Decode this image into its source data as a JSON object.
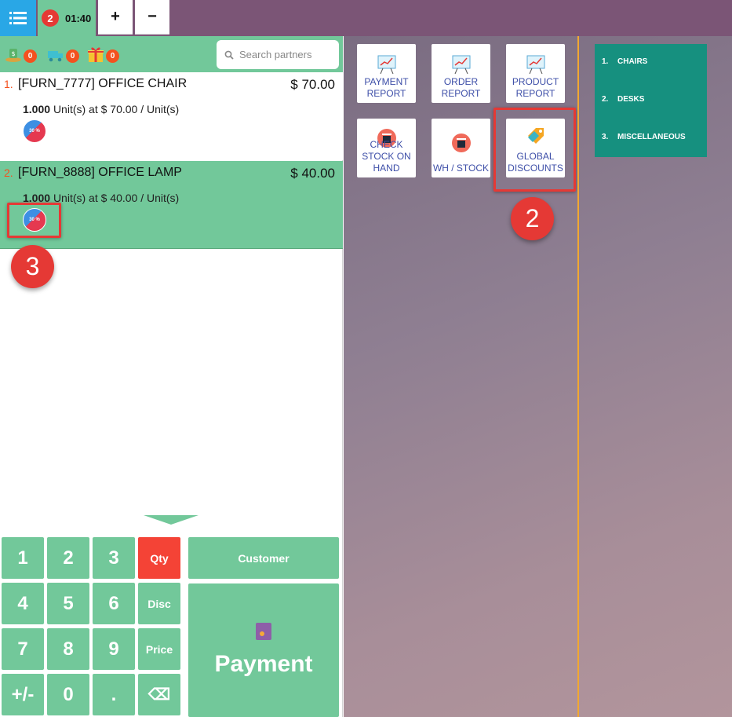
{
  "topbar": {
    "order_count": "2",
    "order_time": "01:40",
    "add_label": "+",
    "remove_label": "−"
  },
  "header": {
    "counters": [
      {
        "icon": "cash-icon",
        "count": "0"
      },
      {
        "icon": "delivery-truck-icon",
        "count": "0"
      },
      {
        "icon": "gift-icon",
        "count": "0"
      }
    ],
    "search_placeholder": "Search partners"
  },
  "order_lines": [
    {
      "index": "1.",
      "name": "[FURN_7777] OFFICE CHAIR",
      "price": "$ 70.00",
      "qty": "1.000",
      "unit_text": "Unit(s) at $ 70.00 / Unit(s)"
    },
    {
      "index": "2.",
      "name": "[FURN_8888] OFFICE LAMP",
      "price": "$ 40.00",
      "qty": "1.000",
      "unit_text": "Unit(s) at $ 40.00 / Unit(s)"
    }
  ],
  "promo_badge_text": "30 %",
  "annotations": {
    "step_2": "2",
    "step_3": "3"
  },
  "numpad": {
    "keys": [
      "1",
      "2",
      "3",
      "4",
      "5",
      "6",
      "7",
      "8",
      "9",
      "+/-",
      "0",
      "."
    ],
    "modes": {
      "qty": "Qty",
      "disc": "Disc",
      "price": "Price"
    },
    "backspace": "⌫"
  },
  "actions": {
    "customer": "Customer",
    "payment": "Payment"
  },
  "tiles": [
    {
      "label": "PAYMENT REPORT",
      "icon": "chart-report-icon"
    },
    {
      "label": "ORDER REPORT",
      "icon": "chart-report-icon"
    },
    {
      "label": "PRODUCT REPORT",
      "icon": "chart-report-icon"
    },
    {
      "label": "CHECK STOCK ON HAND",
      "icon": "stock-icon"
    },
    {
      "label": "WH / STOCK",
      "icon": "stock-icon"
    },
    {
      "label": "GLOBAL DISCOUNTS",
      "icon": "discount-tag-icon"
    }
  ],
  "categories": [
    {
      "num": "1.",
      "name": "CHAIRS"
    },
    {
      "num": "2.",
      "name": "DESKS"
    },
    {
      "num": "3.",
      "name": "MISCELLANEOUS"
    }
  ],
  "colors": {
    "topbar": "#7b5576",
    "accent_green": "#72c89a",
    "menu_blue": "#29a7e6",
    "active_red": "#f44336",
    "category_teal": "#16907f",
    "divider_orange": "#f2a830"
  }
}
